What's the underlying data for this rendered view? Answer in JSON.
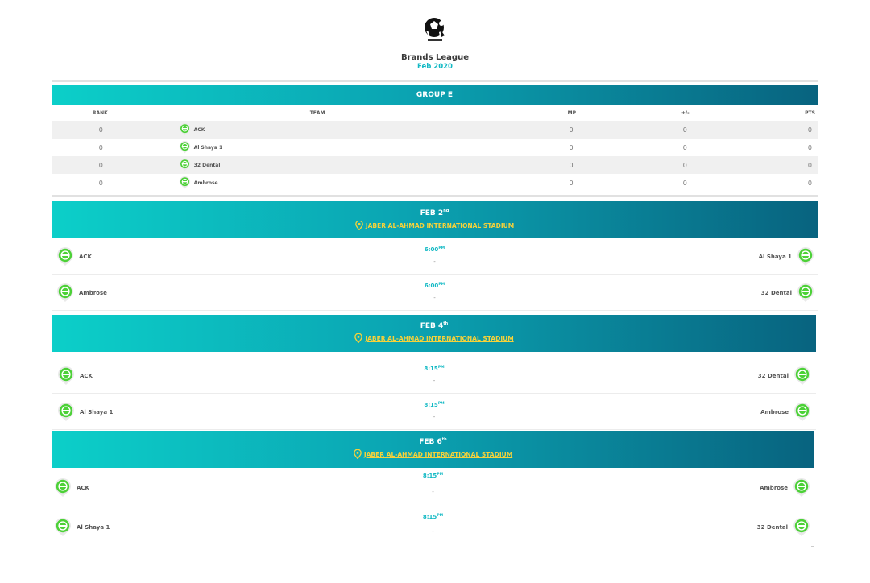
{
  "league": {
    "name": "Brands League",
    "date": "Feb 2020"
  },
  "group": {
    "title": "GROUP E",
    "columns": {
      "rank": "RANK",
      "team": "TEAM",
      "mp": "MP",
      "diff": "+/-",
      "pts": "PTS"
    },
    "rows": [
      {
        "rank": "0",
        "team": "ACK",
        "mp": "0",
        "diff": "0",
        "pts": "0"
      },
      {
        "rank": "0",
        "team": "Al Shaya 1",
        "mp": "0",
        "diff": "0",
        "pts": "0"
      },
      {
        "rank": "0",
        "team": "32 Dental",
        "mp": "0",
        "diff": "0",
        "pts": "0"
      },
      {
        "rank": "0",
        "team": "Ambrose",
        "mp": "0",
        "diff": "0",
        "pts": "0"
      }
    ]
  },
  "days": [
    {
      "date": "FEB 2",
      "suffix": "nd",
      "venue": "JABER AL-AHMAD INTERNATIONAL STADIUM",
      "matches": [
        {
          "home": "ACK",
          "away": "Al Shaya 1",
          "time": "6:00",
          "ampm": "PM",
          "score": "-"
        },
        {
          "home": "Ambrose",
          "away": "32 Dental",
          "time": "6:00",
          "ampm": "PM",
          "score": "-"
        }
      ]
    },
    {
      "date": "FEB 4",
      "suffix": "th",
      "venue": "JABER AL-AHMAD INTERNATIONAL STADIUM",
      "matches": [
        {
          "home": "ACK",
          "away": "32 Dental",
          "time": "8:15",
          "ampm": "PM",
          "score": "-"
        },
        {
          "home": "Al Shaya 1",
          "away": "Ambrose",
          "time": "8:15",
          "ampm": "PM",
          "score": "-"
        }
      ]
    },
    {
      "date": "FEB 6",
      "suffix": "th",
      "venue": "JABER AL-AHMAD INTERNATIONAL STADIUM",
      "matches": [
        {
          "home": "ACK",
          "away": "Ambrose",
          "time": "8:15",
          "ampm": "PM",
          "score": "-"
        },
        {
          "home": "Al Shaya 1",
          "away": "32 Dental",
          "time": "8:15",
          "ampm": "PM",
          "score": "-"
        }
      ]
    }
  ],
  "icons": {
    "team": "team-badge-icon",
    "venue": "location-pin-icon",
    "logo": "soccer-ball-logo"
  },
  "colors": {
    "accent": "#12b9c4",
    "bar_start": "#0ccfc9",
    "bar_end": "#08637f",
    "venue": "#f6d23a",
    "badge": "#4cd137"
  }
}
